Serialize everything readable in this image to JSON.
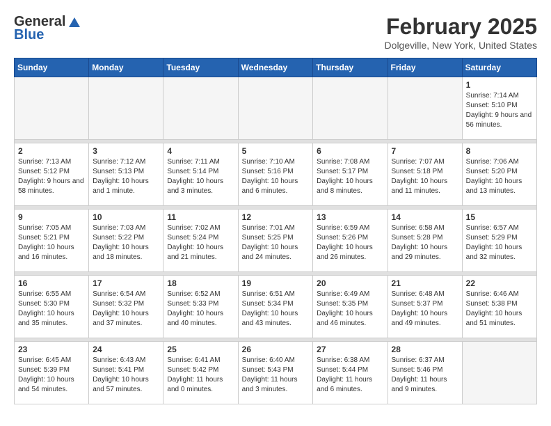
{
  "header": {
    "logo_general": "General",
    "logo_blue": "Blue",
    "month_title": "February 2025",
    "location": "Dolgeville, New York, United States"
  },
  "weekdays": [
    "Sunday",
    "Monday",
    "Tuesday",
    "Wednesday",
    "Thursday",
    "Friday",
    "Saturday"
  ],
  "weeks": [
    {
      "days": [
        {
          "num": "",
          "empty": true
        },
        {
          "num": "",
          "empty": true
        },
        {
          "num": "",
          "empty": true
        },
        {
          "num": "",
          "empty": true
        },
        {
          "num": "",
          "empty": true
        },
        {
          "num": "",
          "empty": true
        },
        {
          "num": "1",
          "sunrise": "7:14 AM",
          "sunset": "5:10 PM",
          "daylight": "Daylight: 9 hours and 56 minutes."
        }
      ]
    },
    {
      "days": [
        {
          "num": "2",
          "sunrise": "7:13 AM",
          "sunset": "5:12 PM",
          "daylight": "Daylight: 9 hours and 58 minutes."
        },
        {
          "num": "3",
          "sunrise": "7:12 AM",
          "sunset": "5:13 PM",
          "daylight": "Daylight: 10 hours and 1 minute."
        },
        {
          "num": "4",
          "sunrise": "7:11 AM",
          "sunset": "5:14 PM",
          "daylight": "Daylight: 10 hours and 3 minutes."
        },
        {
          "num": "5",
          "sunrise": "7:10 AM",
          "sunset": "5:16 PM",
          "daylight": "Daylight: 10 hours and 6 minutes."
        },
        {
          "num": "6",
          "sunrise": "7:08 AM",
          "sunset": "5:17 PM",
          "daylight": "Daylight: 10 hours and 8 minutes."
        },
        {
          "num": "7",
          "sunrise": "7:07 AM",
          "sunset": "5:18 PM",
          "daylight": "Daylight: 10 hours and 11 minutes."
        },
        {
          "num": "8",
          "sunrise": "7:06 AM",
          "sunset": "5:20 PM",
          "daylight": "Daylight: 10 hours and 13 minutes."
        }
      ]
    },
    {
      "days": [
        {
          "num": "9",
          "sunrise": "7:05 AM",
          "sunset": "5:21 PM",
          "daylight": "Daylight: 10 hours and 16 minutes."
        },
        {
          "num": "10",
          "sunrise": "7:03 AM",
          "sunset": "5:22 PM",
          "daylight": "Daylight: 10 hours and 18 minutes."
        },
        {
          "num": "11",
          "sunrise": "7:02 AM",
          "sunset": "5:24 PM",
          "daylight": "Daylight: 10 hours and 21 minutes."
        },
        {
          "num": "12",
          "sunrise": "7:01 AM",
          "sunset": "5:25 PM",
          "daylight": "Daylight: 10 hours and 24 minutes."
        },
        {
          "num": "13",
          "sunrise": "6:59 AM",
          "sunset": "5:26 PM",
          "daylight": "Daylight: 10 hours and 26 minutes."
        },
        {
          "num": "14",
          "sunrise": "6:58 AM",
          "sunset": "5:28 PM",
          "daylight": "Daylight: 10 hours and 29 minutes."
        },
        {
          "num": "15",
          "sunrise": "6:57 AM",
          "sunset": "5:29 PM",
          "daylight": "Daylight: 10 hours and 32 minutes."
        }
      ]
    },
    {
      "days": [
        {
          "num": "16",
          "sunrise": "6:55 AM",
          "sunset": "5:30 PM",
          "daylight": "Daylight: 10 hours and 35 minutes."
        },
        {
          "num": "17",
          "sunrise": "6:54 AM",
          "sunset": "5:32 PM",
          "daylight": "Daylight: 10 hours and 37 minutes."
        },
        {
          "num": "18",
          "sunrise": "6:52 AM",
          "sunset": "5:33 PM",
          "daylight": "Daylight: 10 hours and 40 minutes."
        },
        {
          "num": "19",
          "sunrise": "6:51 AM",
          "sunset": "5:34 PM",
          "daylight": "Daylight: 10 hours and 43 minutes."
        },
        {
          "num": "20",
          "sunrise": "6:49 AM",
          "sunset": "5:35 PM",
          "daylight": "Daylight: 10 hours and 46 minutes."
        },
        {
          "num": "21",
          "sunrise": "6:48 AM",
          "sunset": "5:37 PM",
          "daylight": "Daylight: 10 hours and 49 minutes."
        },
        {
          "num": "22",
          "sunrise": "6:46 AM",
          "sunset": "5:38 PM",
          "daylight": "Daylight: 10 hours and 51 minutes."
        }
      ]
    },
    {
      "days": [
        {
          "num": "23",
          "sunrise": "6:45 AM",
          "sunset": "5:39 PM",
          "daylight": "Daylight: 10 hours and 54 minutes."
        },
        {
          "num": "24",
          "sunrise": "6:43 AM",
          "sunset": "5:41 PM",
          "daylight": "Daylight: 10 hours and 57 minutes."
        },
        {
          "num": "25",
          "sunrise": "6:41 AM",
          "sunset": "5:42 PM",
          "daylight": "Daylight: 11 hours and 0 minutes."
        },
        {
          "num": "26",
          "sunrise": "6:40 AM",
          "sunset": "5:43 PM",
          "daylight": "Daylight: 11 hours and 3 minutes."
        },
        {
          "num": "27",
          "sunrise": "6:38 AM",
          "sunset": "5:44 PM",
          "daylight": "Daylight: 11 hours and 6 minutes."
        },
        {
          "num": "28",
          "sunrise": "6:37 AM",
          "sunset": "5:46 PM",
          "daylight": "Daylight: 11 hours and 9 minutes."
        },
        {
          "num": "",
          "empty": true
        }
      ]
    }
  ]
}
